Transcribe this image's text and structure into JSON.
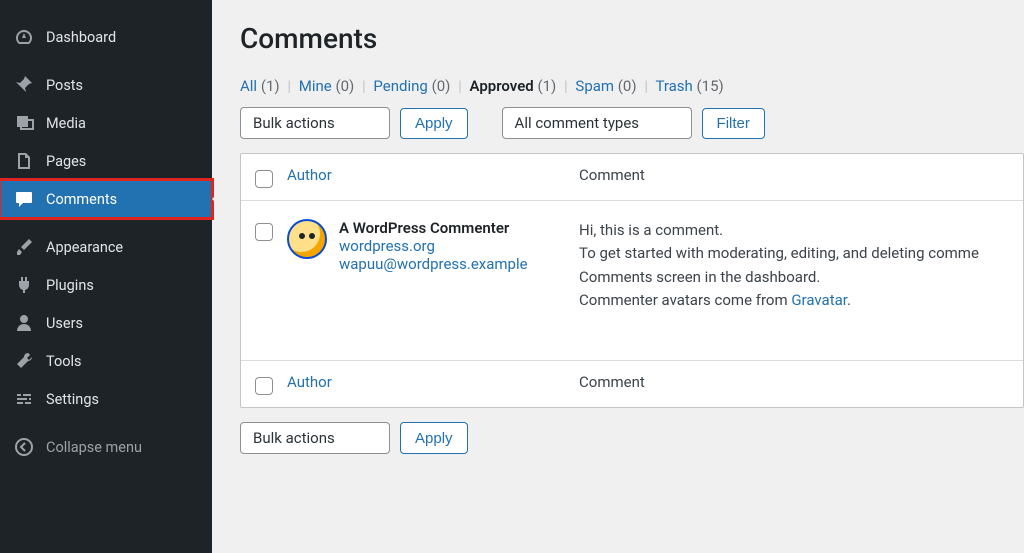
{
  "sidebar": {
    "items": [
      {
        "id": "dashboard",
        "label": "Dashboard",
        "icon": "gauge"
      },
      {
        "id": "posts",
        "label": "Posts",
        "icon": "pin"
      },
      {
        "id": "media",
        "label": "Media",
        "icon": "media"
      },
      {
        "id": "pages",
        "label": "Pages",
        "icon": "pages"
      },
      {
        "id": "comments",
        "label": "Comments",
        "icon": "comment"
      },
      {
        "id": "appearance",
        "label": "Appearance",
        "icon": "brush"
      },
      {
        "id": "plugins",
        "label": "Plugins",
        "icon": "plug"
      },
      {
        "id": "users",
        "label": "Users",
        "icon": "user"
      },
      {
        "id": "tools",
        "label": "Tools",
        "icon": "wrench"
      },
      {
        "id": "settings",
        "label": "Settings",
        "icon": "sliders"
      },
      {
        "id": "collapse",
        "label": "Collapse menu",
        "icon": "collapse"
      }
    ],
    "current": "comments"
  },
  "page": {
    "title": "Comments"
  },
  "filters": {
    "all": {
      "label": "All",
      "count": "(1)"
    },
    "mine": {
      "label": "Mine",
      "count": "(0)"
    },
    "pending": {
      "label": "Pending",
      "count": "(0)"
    },
    "approved": {
      "label": "Approved",
      "count": "(1)"
    },
    "spam": {
      "label": "Spam",
      "count": "(0)"
    },
    "trash": {
      "label": "Trash",
      "count": "(15)"
    }
  },
  "toolbar": {
    "bulk_label": "Bulk actions",
    "apply_label": "Apply",
    "type_label": "All comment types",
    "filter_label": "Filter"
  },
  "table": {
    "columns": {
      "author": "Author",
      "comment": "Comment"
    },
    "rows": [
      {
        "author_name": "A WordPress Commenter",
        "author_url": "wordpress.org",
        "author_email": "wapuu@wordpress.example",
        "body_line1": "Hi, this is a comment.",
        "body_line2": "To get started with moderating, editing, and deleting comme",
        "body_line3": "Comments screen in the dashboard.",
        "body_line4a": "Commenter avatars come from ",
        "body_line4_link": "Gravatar",
        "body_line4b": "."
      }
    ]
  }
}
